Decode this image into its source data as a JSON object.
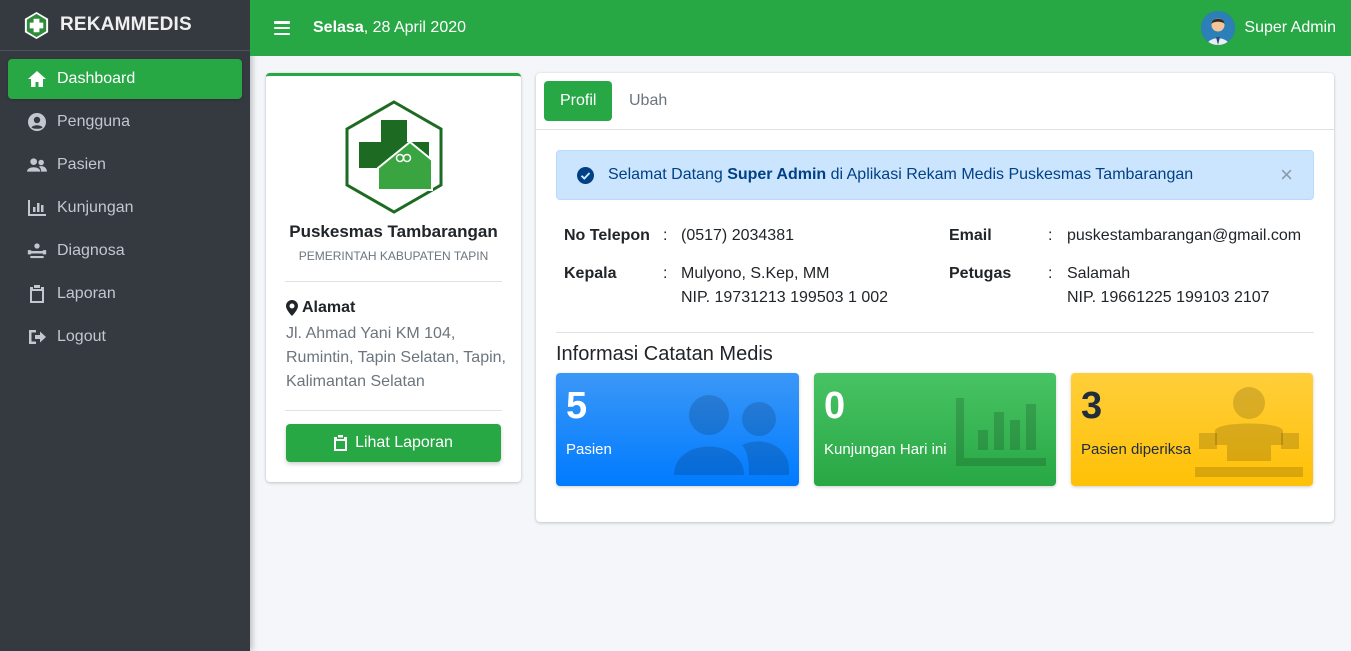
{
  "brand": {
    "name": "REKAMMEDIS"
  },
  "sidebar": {
    "items": [
      {
        "label": "Dashboard",
        "icon": "home-icon",
        "active": true
      },
      {
        "label": "Pengguna",
        "icon": "user-circle-icon",
        "active": false
      },
      {
        "label": "Pasien",
        "icon": "users-icon",
        "active": false
      },
      {
        "label": "Kunjungan",
        "icon": "chart-bar-icon",
        "active": false
      },
      {
        "label": "Diagnosa",
        "icon": "diagnosa-icon",
        "active": false
      },
      {
        "label": "Laporan",
        "icon": "clipboard-icon",
        "active": false
      },
      {
        "label": "Logout",
        "icon": "logout-icon",
        "active": false
      }
    ]
  },
  "header": {
    "day": "Selasa",
    "date": ", 28 April 2020",
    "user_name": "Super Admin"
  },
  "profile": {
    "name": "Puskesmas Tambarangan",
    "subtitle": "PEMERINTAH KABUPATEN TAPIN",
    "address_label": "Alamat",
    "address": "Jl. Ahmad Yani KM 104, Rumintin, Tapin Selatan, Tapin, Kalimantan Selatan",
    "button_label": "Lihat Laporan"
  },
  "tabs": [
    {
      "label": "Profil",
      "active": true
    },
    {
      "label": "Ubah",
      "active": false
    }
  ],
  "alert": {
    "prefix": "Selamat Datang ",
    "user": "Super Admin",
    "suffix": " di Aplikasi Rekam Medis Puskesmas Tambarangan",
    "close": "×"
  },
  "info": {
    "telepon_label": "No Telepon",
    "telepon": "(0517) 2034381",
    "email_label": "Email",
    "email": "puskestambarangan@gmail.com",
    "kepala_label": "Kepala",
    "kepala": "Mulyono, S.Kep, MM",
    "kepala_nip": "NIP. 19731213 199503 1 002",
    "petugas_label": "Petugas",
    "petugas": "Salamah",
    "petugas_nip": "NIP. 19661225 199103 2107",
    "colon": ":"
  },
  "section_title": "Informasi Catatan Medis",
  "stats": [
    {
      "value": "5",
      "label": "Pasien",
      "color": "#007bff"
    },
    {
      "value": "0",
      "label": "Kunjungan Hari ini",
      "color": "#28a745"
    },
    {
      "value": "3",
      "label": "Pasien diperiksa",
      "color": "#ffc107"
    }
  ],
  "colors": {
    "primary": "#28a745",
    "sidebar": "#343a40",
    "alert_bg": "#cce5ff"
  }
}
